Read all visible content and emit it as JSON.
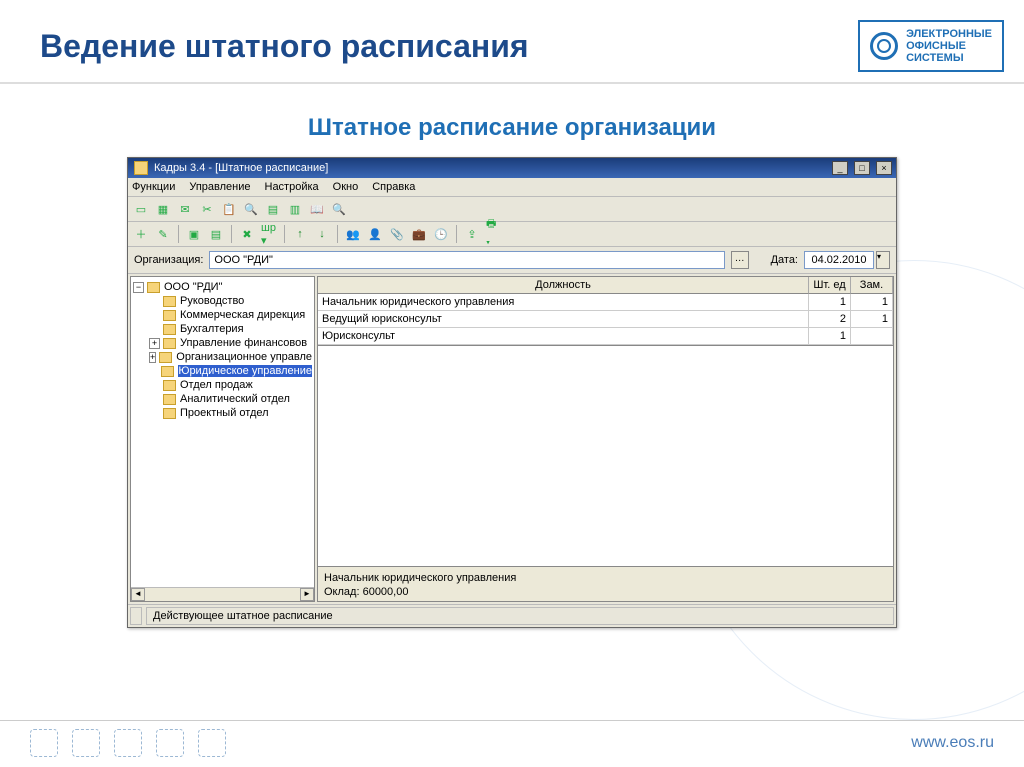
{
  "slide": {
    "title": "Ведение штатного расписания",
    "subtitle": "Штатное расписание организации",
    "brand_line1": "ЭЛЕКТРОННЫЕ",
    "brand_line2": "ОФИСНЫЕ",
    "brand_line3": "СИСТЕМЫ",
    "footer_url": "www.eos.ru"
  },
  "window": {
    "title": "Кадры 3.4 - [Штатное расписание]"
  },
  "menu": {
    "functions": "Функции",
    "control": "Управление",
    "settings": "Настройка",
    "window": "Окно",
    "help": "Справка"
  },
  "filter": {
    "org_label": "Организация:",
    "org_value": "ООО \"РДИ\"",
    "date_label": "Дата:",
    "date_value": "04.02.2010"
  },
  "tree": {
    "root": "ООО \"РДИ\"",
    "children": [
      "Руководство",
      "Коммерческая дирекция",
      "Бухгалтерия",
      "Управление финансовов",
      "Организационное управле",
      "Юридическое управление",
      "Отдел продаж",
      "Аналитический отдел",
      "Проектный отдел"
    ],
    "selected_index": 5,
    "expandable": [
      3,
      4
    ]
  },
  "grid": {
    "headers": {
      "position": "Должность",
      "units": "Шт. ед",
      "subst": "Зам."
    },
    "rows": [
      {
        "position": "Начальник юридического управления",
        "units": "1",
        "subst": "1"
      },
      {
        "position": "Ведущий юрисконсульт",
        "units": "2",
        "subst": "1"
      },
      {
        "position": "Юрисконсульт",
        "units": "1",
        "subst": ""
      }
    ]
  },
  "detail": {
    "selected_label": "Начальник юридического управления",
    "salary_label": "Оклад:",
    "salary_value": "60000,00"
  },
  "status": {
    "text": "Действующее штатное расписание"
  }
}
